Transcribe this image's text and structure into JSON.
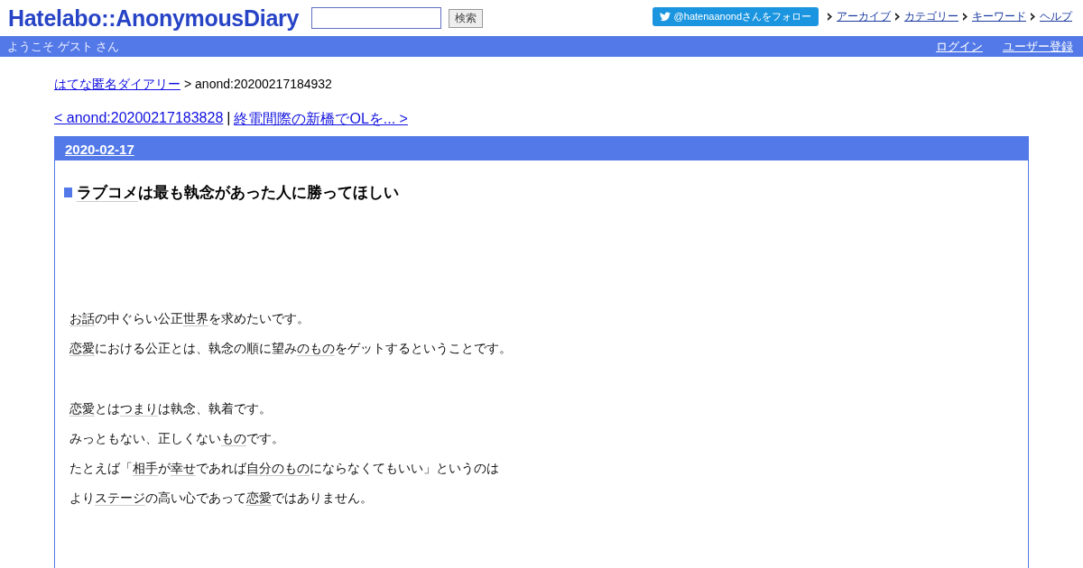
{
  "header": {
    "logo": "Hatelabo::AnonymousDiary",
    "search": {
      "button": "検索"
    },
    "follow_button": "@hatenaanondさんをフォロー",
    "nav": [
      "アーカイブ",
      "カテゴリー",
      "キーワード",
      "ヘルプ"
    ]
  },
  "welcome_bar": {
    "greeting": "ようこそ ゲスト さん",
    "links": [
      "ログイン",
      "ユーザー登録"
    ]
  },
  "breadcrumb": {
    "link": "はてな匿名ダイアリー",
    "current": "> anond:20200217184932"
  },
  "pager": {
    "prev": "< anond:20200217183828",
    "separator": "|",
    "next": "終電間際の新橋でOLを... >"
  },
  "entry": {
    "date": "2020-02-17",
    "title": [
      {
        "text": "ラブコメ",
        "keyword": true
      },
      {
        "text": "は最も執念があった人に勝ってほしい",
        "keyword": false
      }
    ],
    "blocks": [
      [
        [
          {
            "text": "お話",
            "keyword": true
          },
          {
            "text": "の中ぐらい公正",
            "keyword": false
          },
          {
            "text": "世界",
            "keyword": true
          },
          {
            "text": "を求めたいです。",
            "keyword": false
          }
        ],
        [
          {
            "text": "恋愛",
            "keyword": true
          },
          {
            "text": "における公正とは、執念の順に望み",
            "keyword": false
          },
          {
            "text": "のもの",
            "keyword": true
          },
          {
            "text": "をゲットするということです。",
            "keyword": false
          }
        ]
      ],
      [
        [
          {
            "text": "恋愛",
            "keyword": true
          },
          {
            "text": "とは",
            "keyword": false
          },
          {
            "text": "つまり",
            "keyword": true
          },
          {
            "text": "は執念、執着です。",
            "keyword": false
          }
        ],
        [
          {
            "text": "みっともない、正しくない",
            "keyword": false
          },
          {
            "text": "もの",
            "keyword": true
          },
          {
            "text": "です。",
            "keyword": false
          }
        ],
        [
          {
            "text": "たとえば「",
            "keyword": false
          },
          {
            "text": "相手",
            "keyword": true
          },
          {
            "text": "が",
            "keyword": false
          },
          {
            "text": "幸せ",
            "keyword": true
          },
          {
            "text": "であれば",
            "keyword": false
          },
          {
            "text": "自分のもの",
            "keyword": true
          },
          {
            "text": "にならなくてもいい」というのは",
            "keyword": false
          }
        ],
        [
          {
            "text": "より",
            "keyword": false
          },
          {
            "text": "ステージ",
            "keyword": true
          },
          {
            "text": "の高い心であって",
            "keyword": false
          },
          {
            "text": "恋愛",
            "keyword": true
          },
          {
            "text": "ではありません。",
            "keyword": false
          }
        ]
      ]
    ]
  }
}
